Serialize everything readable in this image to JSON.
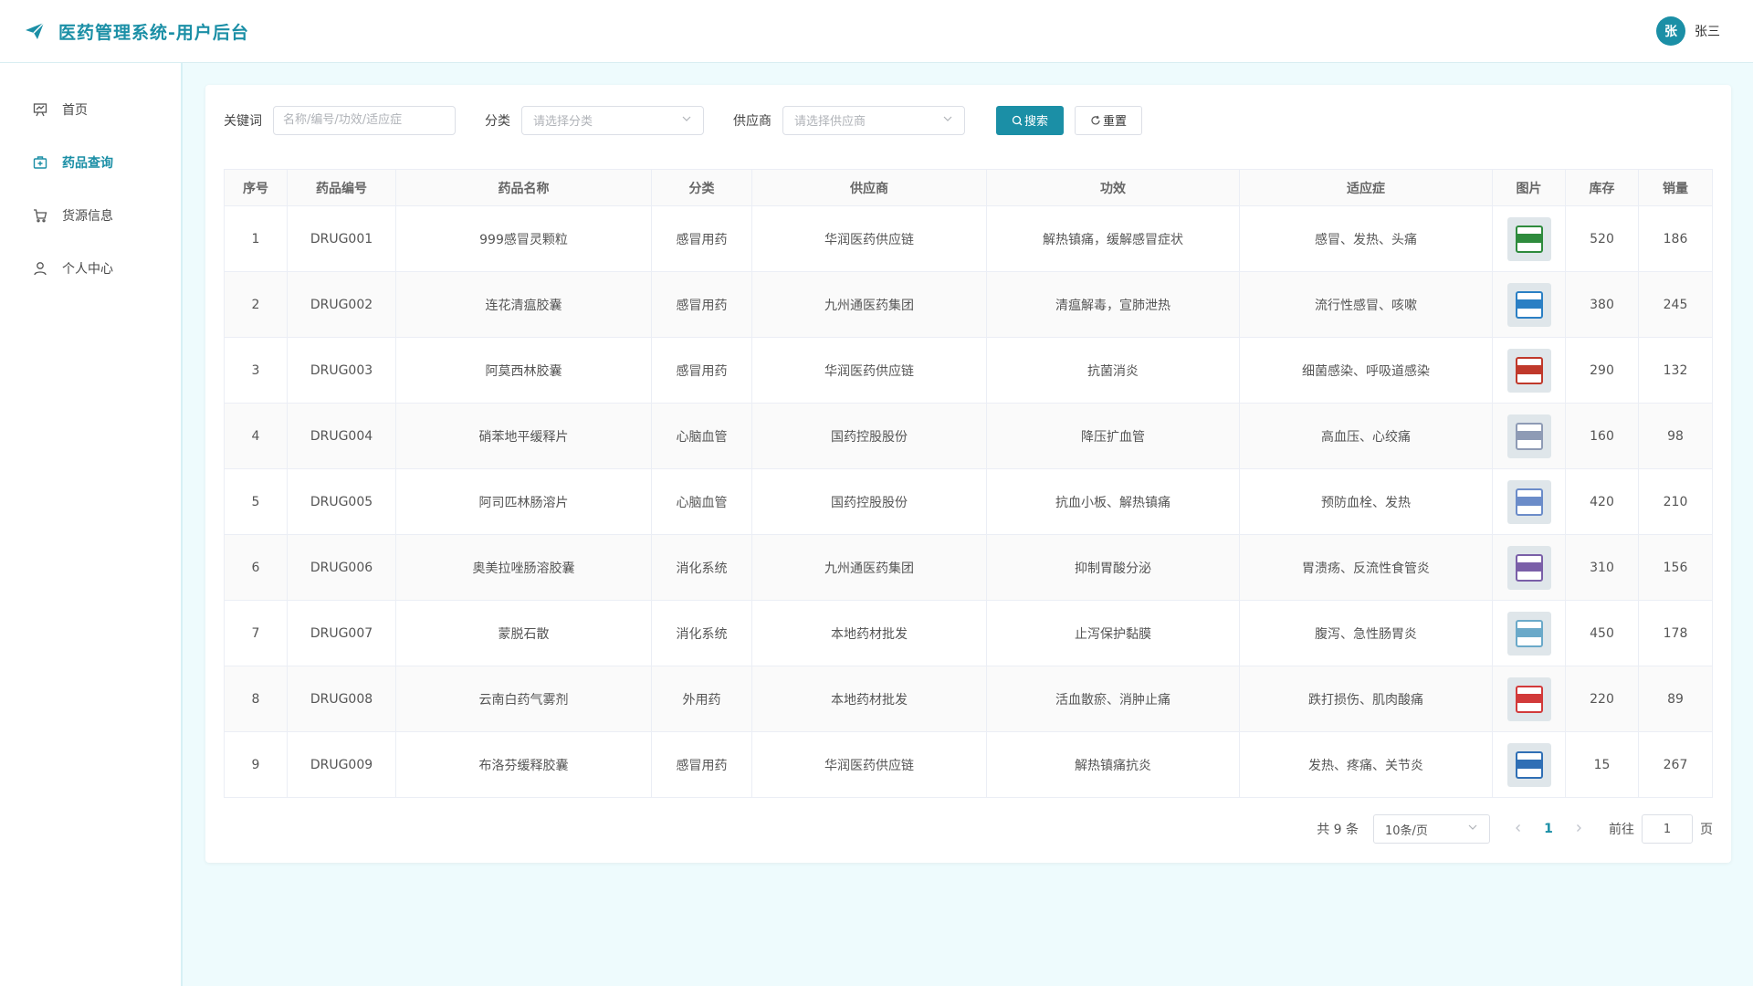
{
  "header": {
    "app_title": "医药管理系统-用户后台",
    "avatar_text": "张",
    "username": "张三"
  },
  "colors": {
    "primary": "#1b8fa6",
    "page_bg": "#eefbfd"
  },
  "sidebar": {
    "items": [
      {
        "label": "首页",
        "icon": "easel-icon",
        "active": false
      },
      {
        "label": "药品查询",
        "icon": "medicine-box-icon",
        "active": true
      },
      {
        "label": "货源信息",
        "icon": "cart-icon",
        "active": false
      },
      {
        "label": "个人中心",
        "icon": "user-icon",
        "active": false
      }
    ]
  },
  "filters": {
    "keyword_label": "关键词",
    "keyword_placeholder": "名称/编号/功效/适应症",
    "category_label": "分类",
    "category_placeholder": "请选择分类",
    "supplier_label": "供应商",
    "supplier_placeholder": "请选择供应商",
    "search_label": "搜索",
    "reset_label": "重置"
  },
  "table": {
    "headers": [
      "序号",
      "药品编号",
      "药品名称",
      "分类",
      "供应商",
      "功效",
      "适应症",
      "图片",
      "库存",
      "销量"
    ],
    "rows": [
      [
        "1",
        "DRUG001",
        "999感冒灵颗粒",
        "感冒用药",
        "华润医药供应链",
        "解热镇痛，缓解感冒症状",
        "感冒、发热、头痛",
        "",
        "520",
        "186"
      ],
      [
        "2",
        "DRUG002",
        "连花清瘟胶囊",
        "感冒用药",
        "九州通医药集团",
        "清瘟解毒，宣肺泄热",
        "流行性感冒、咳嗽",
        "",
        "380",
        "245"
      ],
      [
        "3",
        "DRUG003",
        "阿莫西林胶囊",
        "感冒用药",
        "华润医药供应链",
        "抗菌消炎",
        "细菌感染、呼吸道感染",
        "",
        "290",
        "132"
      ],
      [
        "4",
        "DRUG004",
        "硝苯地平缓释片",
        "心脑血管",
        "国药控股股份",
        "降压扩血管",
        "高血压、心绞痛",
        "",
        "160",
        "98"
      ],
      [
        "5",
        "DRUG005",
        "阿司匹林肠溶片",
        "心脑血管",
        "国药控股股份",
        "抗血小板、解热镇痛",
        "预防血栓、发热",
        "",
        "420",
        "210"
      ],
      [
        "6",
        "DRUG006",
        "奥美拉唑肠溶胶囊",
        "消化系统",
        "九州通医药集团",
        "抑制胃酸分泌",
        "胃溃疡、反流性食管炎",
        "",
        "310",
        "156"
      ],
      [
        "7",
        "DRUG007",
        "蒙脱石散",
        "消化系统",
        "本地药材批发",
        "止泻保护黏膜",
        "腹泻、急性肠胃炎",
        "",
        "450",
        "178"
      ],
      [
        "8",
        "DRUG008",
        "云南白药气雾剂",
        "外用药",
        "本地药材批发",
        "活血散瘀、消肿止痛",
        "跌打损伤、肌肉酸痛",
        "",
        "220",
        "89"
      ],
      [
        "9",
        "DRUG009",
        "布洛芬缓释胶囊",
        "感冒用药",
        "华润医药供应链",
        "解热镇痛抗炎",
        "发热、疼痛、关节炎",
        "",
        "15",
        "267"
      ]
    ],
    "thumb_colors": [
      "#2e8b3d",
      "#2a7fc4",
      "#c0392b",
      "#8e9bb5",
      "#6b8cc9",
      "#7a5fa8",
      "#6aa9c9",
      "#d23a3a",
      "#2f6fb5"
    ]
  },
  "pagination": {
    "total_text": "共 9 条",
    "page_size": "10条/页",
    "current_page": "1",
    "goto_label": "前往",
    "goto_value": "1",
    "page_suffix": "页"
  }
}
